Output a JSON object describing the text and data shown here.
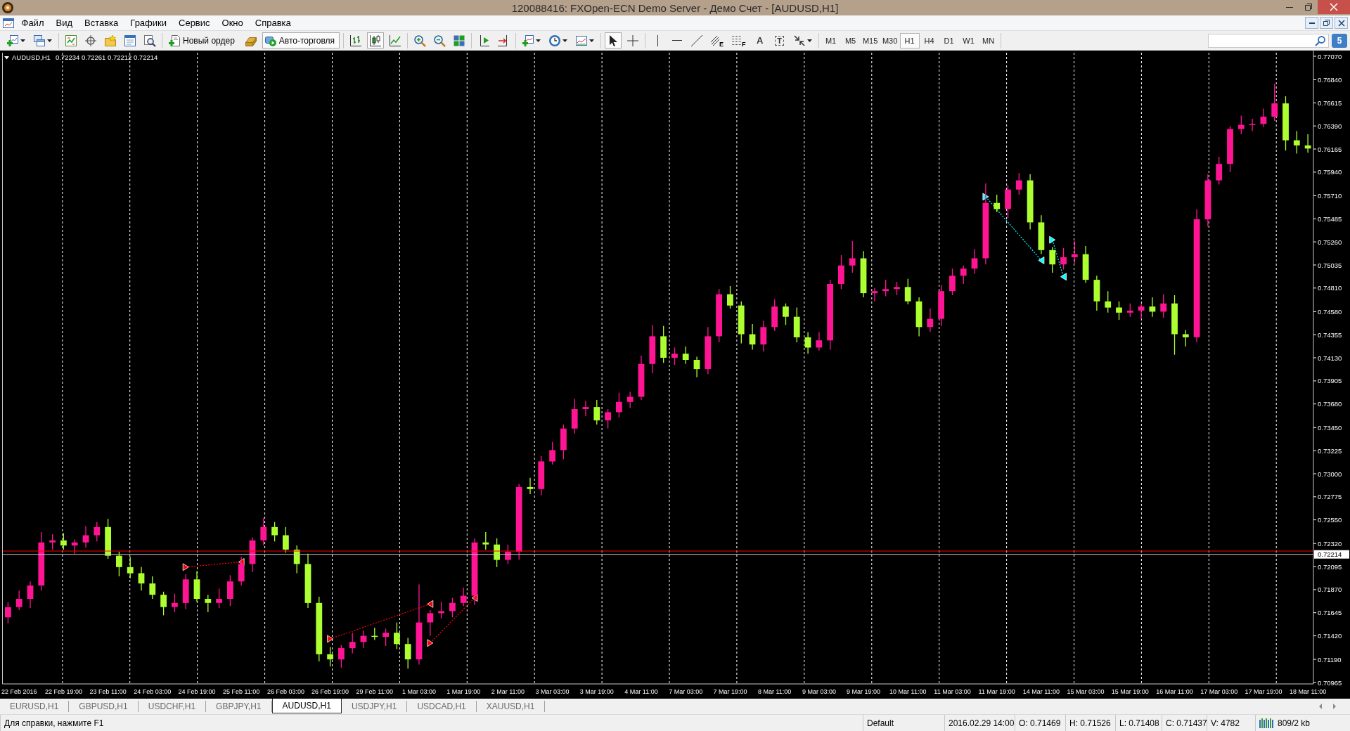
{
  "window": {
    "title": "120088416: FXOpen-ECN Demo Server - Демо Счет - [AUDUSD,H1]"
  },
  "menu": [
    "Файл",
    "Вид",
    "Вставка",
    "Графики",
    "Сервис",
    "Окно",
    "Справка"
  ],
  "toolbar": {
    "new_order": "Новый ордер",
    "auto_trading": {
      "label": "Авто-торговля",
      "on": true
    },
    "chart_types": [
      {
        "selected": false
      },
      {
        "selected": true
      },
      {
        "selected": false
      }
    ],
    "cursor_tools": [
      {
        "selected": true
      },
      {
        "selected": false
      }
    ],
    "object_tools": {
      "channel": "E",
      "fibonacci": "F",
      "text": "A",
      "text_label": "T"
    },
    "timeframes": [
      {
        "label": "M1",
        "selected": false
      },
      {
        "label": "M5",
        "selected": false
      },
      {
        "label": "M15",
        "selected": false
      },
      {
        "label": "M30",
        "selected": false
      },
      {
        "label": "H1",
        "selected": true
      },
      {
        "label": "H4",
        "selected": false
      },
      {
        "label": "D1",
        "selected": false
      },
      {
        "label": "W1",
        "selected": false
      },
      {
        "label": "MN",
        "selected": false
      }
    ],
    "messages": "5"
  },
  "chart": {
    "chart_data": [
      {
        "type": "candlestick",
        "title": "AUDUSD,H1",
        "subtitle": "0.72234 0.72261 0.72212 0.72214",
        "categories": [
          null,
          "22 Feb 2016",
          null,
          null,
          null,
          "22 Feb 19:00",
          null,
          null,
          null,
          "23 Feb 11:00",
          null,
          null,
          null,
          "24 Feb 03:00",
          null,
          null,
          null,
          "24 Feb 19:00",
          null,
          null,
          null,
          "25 Feb 11:00",
          null,
          null,
          null,
          "26 Feb 03:00",
          null,
          null,
          null,
          "26 Feb 19:00",
          null,
          null,
          null,
          "29 Feb 11:00",
          null,
          null,
          null,
          "1 Mar 03:00",
          null,
          null,
          null,
          "1 Mar 19:00",
          null,
          null,
          null,
          "2 Mar 11:00",
          null,
          null,
          null,
          "3 Mar 03:00",
          null,
          null,
          null,
          "3 Mar 19:00",
          null,
          null,
          null,
          "4 Mar 11:00",
          null,
          null,
          null,
          "7 Mar 03:00",
          null,
          null,
          null,
          "7 Mar 19:00",
          null,
          null,
          null,
          "8 Mar 11:00",
          null,
          null,
          null,
          "9 Mar 03:00",
          null,
          null,
          null,
          "9 Mar 19:00",
          null,
          null,
          null,
          "10 Mar 11:00",
          null,
          null,
          null,
          "11 Mar 03:00",
          null,
          null,
          null,
          "11 Mar 19:00",
          null,
          null,
          null,
          "14 Mar 11:00",
          null,
          null,
          null,
          "15 Mar 03:00",
          null,
          null,
          null,
          "15 Mar 19:00",
          null,
          null,
          null,
          "16 Mar 11:00",
          null,
          null,
          null,
          "17 Mar 03:00",
          null,
          null,
          null,
          "17 Mar 19:00",
          null,
          null,
          null,
          "18 Mar 11:00"
        ],
        "ohlc": [
          [
            0.716,
            0.7175,
            0.7154,
            0.717
          ],
          [
            0.717,
            0.7186,
            0.7167,
            0.7178
          ],
          [
            0.7178,
            0.7195,
            0.7169,
            0.7191
          ],
          [
            0.7191,
            0.7243,
            0.7186,
            0.7233
          ],
          [
            0.7233,
            0.7241,
            0.7226,
            0.7235
          ],
          [
            0.7235,
            0.7242,
            0.7226,
            0.723
          ],
          [
            0.723,
            0.7236,
            0.7222,
            0.7233
          ],
          [
            0.7233,
            0.7249,
            0.7228,
            0.724
          ],
          [
            0.724,
            0.7253,
            0.7234,
            0.7248
          ],
          [
            0.7248,
            0.7256,
            0.7217,
            0.722
          ],
          [
            0.722,
            0.7224,
            0.72,
            0.7209
          ],
          [
            0.7209,
            0.7219,
            0.7198,
            0.7203
          ],
          [
            0.7203,
            0.7209,
            0.7186,
            0.7193
          ],
          [
            0.7193,
            0.72,
            0.7178,
            0.7182
          ],
          [
            0.7182,
            0.7185,
            0.7162,
            0.717
          ],
          [
            0.717,
            0.7183,
            0.7165,
            0.7174
          ],
          [
            0.7174,
            0.7202,
            0.7168,
            0.7197
          ],
          [
            0.7197,
            0.7205,
            0.7175,
            0.7178
          ],
          [
            0.7178,
            0.7182,
            0.7165,
            0.7174
          ],
          [
            0.7174,
            0.7188,
            0.7169,
            0.7178
          ],
          [
            0.7178,
            0.7201,
            0.7171,
            0.7195
          ],
          [
            0.7195,
            0.7219,
            0.7191,
            0.7212
          ],
          [
            0.7212,
            0.7238,
            0.7204,
            0.7235
          ],
          [
            0.7235,
            0.7257,
            0.723,
            0.7248
          ],
          [
            0.7248,
            0.7253,
            0.7234,
            0.724
          ],
          [
            0.724,
            0.7248,
            0.7223,
            0.7226
          ],
          [
            0.7226,
            0.723,
            0.7203,
            0.7212
          ],
          [
            0.7212,
            0.7222,
            0.7169,
            0.7174
          ],
          [
            0.7174,
            0.718,
            0.7117,
            0.7124
          ],
          [
            0.7124,
            0.7131,
            0.7112,
            0.7119
          ],
          [
            0.7119,
            0.7133,
            0.7111,
            0.713
          ],
          [
            0.713,
            0.7145,
            0.7125,
            0.7136
          ],
          [
            0.7136,
            0.7147,
            0.713,
            0.7142
          ],
          [
            0.7142,
            0.715,
            0.7138,
            0.7141
          ],
          [
            0.7141,
            0.7149,
            0.7132,
            0.7145
          ],
          [
            0.7145,
            0.7155,
            0.7129,
            0.7134
          ],
          [
            0.7134,
            0.714,
            0.711,
            0.7119
          ],
          [
            0.7119,
            0.7192,
            0.7114,
            0.7155
          ],
          [
            0.7155,
            0.7167,
            0.7142,
            0.7164
          ],
          [
            0.7164,
            0.7175,
            0.7159,
            0.7166
          ],
          [
            0.7166,
            0.7179,
            0.716,
            0.7174
          ],
          [
            0.7174,
            0.7189,
            0.7171,
            0.7181
          ],
          [
            0.7181,
            0.7237,
            0.7172,
            0.7233
          ],
          [
            0.7233,
            0.7243,
            0.7226,
            0.7231
          ],
          [
            0.7231,
            0.7237,
            0.7209,
            0.7216
          ],
          [
            0.7216,
            0.7231,
            0.7212,
            0.7224
          ],
          [
            0.7224,
            0.729,
            0.7216,
            0.7287
          ],
          [
            0.7287,
            0.7296,
            0.728,
            0.7285
          ],
          [
            0.7285,
            0.7317,
            0.7279,
            0.7312
          ],
          [
            0.7312,
            0.7331,
            0.7309,
            0.7323
          ],
          [
            0.7323,
            0.7348,
            0.7314,
            0.7344
          ],
          [
            0.7344,
            0.7373,
            0.7339,
            0.7363
          ],
          [
            0.7363,
            0.7371,
            0.7356,
            0.7365
          ],
          [
            0.7365,
            0.7372,
            0.7348,
            0.7352
          ],
          [
            0.7352,
            0.7363,
            0.7344,
            0.736
          ],
          [
            0.736,
            0.7379,
            0.7355,
            0.737
          ],
          [
            0.737,
            0.738,
            0.7364,
            0.7375
          ],
          [
            0.7375,
            0.7415,
            0.7372,
            0.7407
          ],
          [
            0.7407,
            0.7445,
            0.7398,
            0.7434
          ],
          [
            0.7434,
            0.7444,
            0.7408,
            0.7413
          ],
          [
            0.7413,
            0.7423,
            0.7406,
            0.7417
          ],
          [
            0.7417,
            0.7424,
            0.7407,
            0.7411
          ],
          [
            0.7411,
            0.7414,
            0.7394,
            0.7402
          ],
          [
            0.7402,
            0.7443,
            0.7397,
            0.7434
          ],
          [
            0.7434,
            0.748,
            0.7428,
            0.7475
          ],
          [
            0.7475,
            0.7483,
            0.7461,
            0.7464
          ],
          [
            0.7464,
            0.7468,
            0.7427,
            0.7436
          ],
          [
            0.7436,
            0.7446,
            0.7421,
            0.7426
          ],
          [
            0.7426,
            0.7449,
            0.7419,
            0.7443
          ],
          [
            0.7443,
            0.747,
            0.7439,
            0.7463
          ],
          [
            0.7463,
            0.7466,
            0.7445,
            0.7453
          ],
          [
            0.7453,
            0.7462,
            0.7428,
            0.7433
          ],
          [
            0.7433,
            0.7438,
            0.7417,
            0.7423
          ],
          [
            0.7423,
            0.7438,
            0.742,
            0.743
          ],
          [
            0.743,
            0.7489,
            0.7421,
            0.7485
          ],
          [
            0.7485,
            0.7513,
            0.748,
            0.7503
          ],
          [
            0.7503,
            0.7527,
            0.7496,
            0.751
          ],
          [
            0.751,
            0.7517,
            0.7472,
            0.7476
          ],
          [
            0.7476,
            0.7481,
            0.7468,
            0.7478
          ],
          [
            0.7478,
            0.7489,
            0.7473,
            0.748
          ],
          [
            0.748,
            0.7487,
            0.7474,
            0.7482
          ],
          [
            0.7482,
            0.749,
            0.7465,
            0.7468
          ],
          [
            0.7468,
            0.7472,
            0.7434,
            0.7443
          ],
          [
            0.7443,
            0.7461,
            0.7438,
            0.7451
          ],
          [
            0.7451,
            0.7484,
            0.7444,
            0.7478
          ],
          [
            0.7478,
            0.75,
            0.7474,
            0.7493
          ],
          [
            0.7493,
            0.7503,
            0.7485,
            0.75
          ],
          [
            0.75,
            0.7519,
            0.7495,
            0.751
          ],
          [
            0.751,
            0.7583,
            0.7504,
            0.7564
          ],
          [
            0.7564,
            0.7572,
            0.7555,
            0.7558
          ],
          [
            0.7558,
            0.7581,
            0.7549,
            0.7577
          ],
          [
            0.7577,
            0.7593,
            0.7572,
            0.7586
          ],
          [
            0.7586,
            0.7592,
            0.7538,
            0.7545
          ],
          [
            0.7545,
            0.7552,
            0.7514,
            0.7518
          ],
          [
            0.7518,
            0.7521,
            0.7496,
            0.7504
          ],
          [
            0.7504,
            0.752,
            0.7499,
            0.7511
          ],
          [
            0.7511,
            0.7527,
            0.7505,
            0.7514
          ],
          [
            0.7514,
            0.7522,
            0.7486,
            0.7489
          ],
          [
            0.7489,
            0.7493,
            0.7459,
            0.7468
          ],
          [
            0.7468,
            0.7478,
            0.7457,
            0.7462
          ],
          [
            0.7462,
            0.7468,
            0.745,
            0.7457
          ],
          [
            0.7457,
            0.7466,
            0.7453,
            0.7459
          ],
          [
            0.7459,
            0.7466,
            0.7451,
            0.7463
          ],
          [
            0.7463,
            0.7472,
            0.7453,
            0.7458
          ],
          [
            0.7458,
            0.7475,
            0.7452,
            0.7466
          ],
          [
            0.7466,
            0.7474,
            0.7416,
            0.7436
          ],
          [
            0.7436,
            0.744,
            0.7424,
            0.7433
          ],
          [
            0.7433,
            0.7558,
            0.7428,
            0.7548
          ],
          [
            0.7548,
            0.7592,
            0.7541,
            0.7586
          ],
          [
            0.7586,
            0.7609,
            0.7582,
            0.7602
          ],
          [
            0.7602,
            0.7639,
            0.7594,
            0.7636
          ],
          [
            0.7636,
            0.7649,
            0.7631,
            0.764
          ],
          [
            0.764,
            0.7646,
            0.7634,
            0.7641
          ],
          [
            0.7641,
            0.7656,
            0.7638,
            0.7648
          ],
          [
            0.7648,
            0.768,
            0.7644,
            0.7661
          ],
          [
            0.7661,
            0.7668,
            0.7615,
            0.7625
          ],
          [
            0.7625,
            0.7634,
            0.7612,
            0.762
          ],
          [
            0.762,
            0.7631,
            0.7613,
            0.7617
          ]
        ],
        "series": [
          {
            "type": "line",
            "color": "#ff0000",
            "line_style": "dotted",
            "marker": "triangle",
            "values": [
              null,
              null,
              null,
              null,
              null,
              null,
              null,
              null,
              null,
              null,
              null,
              null,
              null,
              null,
              null,
              null,
              0.7209,
              null,
              null,
              null,
              null,
              0.7214,
              null,
              null,
              null,
              null,
              null,
              null,
              null,
              null,
              null,
              null,
              null,
              null,
              null,
              null,
              null,
              null,
              null,
              null,
              null,
              null,
              null,
              null,
              null,
              null,
              null,
              null,
              null,
              null,
              null,
              null,
              null,
              null,
              null,
              null,
              null,
              null,
              null,
              null,
              null,
              null,
              null,
              null,
              null,
              null,
              null,
              null,
              null,
              null,
              null,
              null,
              null,
              null,
              null,
              null,
              null,
              null,
              null,
              null,
              null,
              null,
              null,
              null,
              null,
              null,
              null,
              null,
              null,
              null,
              null,
              null,
              null,
              null,
              null,
              null,
              null,
              null,
              null,
              null,
              null,
              null,
              null,
              null,
              null,
              null,
              null,
              null,
              null,
              null,
              null,
              null,
              null,
              null,
              null,
              null,
              null,
              null
            ]
          },
          {
            "type": "line",
            "color": "#ff0000",
            "line_style": "dotted",
            "marker": "triangle",
            "values": [
              null,
              null,
              null,
              null,
              null,
              null,
              null,
              null,
              null,
              null,
              null,
              null,
              null,
              null,
              null,
              null,
              null,
              null,
              null,
              null,
              null,
              null,
              null,
              null,
              null,
              null,
              null,
              null,
              null,
              0.7139,
              null,
              null,
              null,
              null,
              null,
              null,
              null,
              null,
              0.7173,
              null,
              null,
              null,
              null,
              null,
              null,
              null,
              null,
              null,
              null,
              null,
              null,
              null,
              null,
              null,
              null,
              null,
              null,
              null,
              null,
              null,
              null,
              null,
              null,
              null,
              null,
              null,
              null,
              null,
              null,
              null,
              null,
              null,
              null,
              null,
              null,
              null,
              null,
              null,
              null,
              null,
              null,
              null,
              null,
              null,
              null,
              null,
              null,
              null,
              null,
              null,
              null,
              null,
              null,
              null,
              null,
              null,
              null,
              null,
              null,
              null,
              null,
              null,
              null,
              null,
              null,
              null,
              null,
              null,
              null,
              null,
              null,
              null,
              null,
              null,
              null,
              null,
              null,
              null
            ]
          },
          {
            "type": "line",
            "color": "#ff0000",
            "line_style": "dotted",
            "marker": "triangle",
            "values": [
              null,
              null,
              null,
              null,
              null,
              null,
              null,
              null,
              null,
              null,
              null,
              null,
              null,
              null,
              null,
              null,
              null,
              null,
              null,
              null,
              null,
              null,
              null,
              null,
              null,
              null,
              null,
              null,
              null,
              null,
              null,
              null,
              null,
              null,
              null,
              null,
              null,
              null,
              0.7135,
              null,
              null,
              null,
              0.7179,
              null,
              null,
              null,
              null,
              null,
              null,
              null,
              null,
              null,
              null,
              null,
              null,
              null,
              null,
              null,
              null,
              null,
              null,
              null,
              null,
              null,
              null,
              null,
              null,
              null,
              null,
              null,
              null,
              null,
              null,
              null,
              null,
              null,
              null,
              null,
              null,
              null,
              null,
              null,
              null,
              null,
              null,
              null,
              null,
              null,
              null,
              null,
              null,
              null,
              null,
              null,
              null,
              null,
              null,
              null,
              null,
              null,
              null,
              null,
              null,
              null,
              null,
              null,
              null,
              null,
              null,
              null,
              null,
              null,
              null,
              null,
              null,
              null,
              null,
              null
            ]
          },
          {
            "type": "line",
            "color": "#00ffff",
            "line_style": "dotted",
            "marker": "triangle",
            "values": [
              null,
              null,
              null,
              null,
              null,
              null,
              null,
              null,
              null,
              null,
              null,
              null,
              null,
              null,
              null,
              null,
              null,
              null,
              null,
              null,
              null,
              null,
              null,
              null,
              null,
              null,
              null,
              null,
              null,
              null,
              null,
              null,
              null,
              null,
              null,
              null,
              null,
              null,
              null,
              null,
              null,
              null,
              null,
              null,
              null,
              null,
              null,
              null,
              null,
              null,
              null,
              null,
              null,
              null,
              null,
              null,
              null,
              null,
              null,
              null,
              null,
              null,
              null,
              null,
              null,
              null,
              null,
              null,
              null,
              null,
              null,
              null,
              null,
              null,
              null,
              null,
              null,
              null,
              null,
              null,
              null,
              null,
              null,
              null,
              null,
              null,
              null,
              null,
              0.757,
              null,
              null,
              null,
              null,
              0.7508,
              null,
              null,
              null,
              null,
              null,
              null,
              null,
              null,
              null,
              null,
              null,
              null,
              null,
              null,
              null,
              null,
              null,
              null,
              null,
              null,
              null,
              null,
              null,
              null
            ]
          },
          {
            "type": "line",
            "color": "#00ffff",
            "line_style": "dotted",
            "marker": "triangle",
            "values": [
              null,
              null,
              null,
              null,
              null,
              null,
              null,
              null,
              null,
              null,
              null,
              null,
              null,
              null,
              null,
              null,
              null,
              null,
              null,
              null,
              null,
              null,
              null,
              null,
              null,
              null,
              null,
              null,
              null,
              null,
              null,
              null,
              null,
              null,
              null,
              null,
              null,
              null,
              null,
              null,
              null,
              null,
              null,
              null,
              null,
              null,
              null,
              null,
              null,
              null,
              null,
              null,
              null,
              null,
              null,
              null,
              null,
              null,
              null,
              null,
              null,
              null,
              null,
              null,
              null,
              null,
              null,
              null,
              null,
              null,
              null,
              null,
              null,
              null,
              null,
              null,
              null,
              null,
              null,
              null,
              null,
              null,
              null,
              null,
              null,
              null,
              null,
              null,
              null,
              null,
              null,
              null,
              null,
              null,
              0.7528,
              0.7492,
              null,
              null,
              null,
              null,
              null,
              null,
              null,
              null,
              null,
              null,
              null,
              null,
              null,
              null,
              null,
              null,
              null,
              null,
              null,
              null,
              null,
              null
            ]
          }
        ],
        "ylim": [
          0.70951,
          0.77104
        ],
        "yticks": [
          {
            "value": 0.7707,
            "label": "0.77070"
          },
          {
            "value": 0.7684,
            "label": "0.76840"
          },
          {
            "value": 0.76615,
            "label": "0.76615"
          },
          {
            "value": 0.7639,
            "label": "0.76390"
          },
          {
            "value": 0.76165,
            "label": "0.76165"
          },
          {
            "value": 0.7594,
            "label": "0.75940"
          },
          {
            "value": 0.7571,
            "label": "0.75710"
          },
          {
            "value": 0.75485,
            "label": "0.75485"
          },
          {
            "value": 0.7526,
            "label": "0.75260"
          },
          {
            "value": 0.75035,
            "label": "0.75035"
          },
          {
            "value": 0.7481,
            "label": "0.74810"
          },
          {
            "value": 0.7458,
            "label": "0.74580"
          },
          {
            "value": 0.74355,
            "label": "0.74355"
          },
          {
            "value": 0.7413,
            "label": "0.74130"
          },
          {
            "value": 0.73905,
            "label": "0.73905"
          },
          {
            "value": 0.7368,
            "label": "0.73680"
          },
          {
            "value": 0.7345,
            "label": "0.73450"
          },
          {
            "value": 0.73225,
            "label": "0.73225"
          },
          {
            "value": 0.73,
            "label": "0.73000"
          },
          {
            "value": 0.72775,
            "label": "0.72775"
          },
          {
            "value": 0.7255,
            "label": "0.72550"
          },
          {
            "value": 0.7232,
            "label": "0.72320"
          },
          {
            "value": 0.72095,
            "label": "0.72095"
          },
          {
            "value": 0.7187,
            "label": "0.71870"
          },
          {
            "value": 0.71645,
            "label": "0.71645"
          },
          {
            "value": 0.7142,
            "label": "0.71420"
          },
          {
            "value": 0.7119,
            "label": "0.71190"
          },
          {
            "value": 0.70965,
            "label": "0.70965"
          }
        ],
        "ref_lines": [
          {
            "axis": "y",
            "value": 0.72246,
            "color": "#ff0000",
            "line_style": "solid"
          },
          {
            "axis": "y",
            "value": 0.72214,
            "label": "0.72214",
            "color": "#c0c0c0",
            "line_style": "solid"
          }
        ]
      }
    ]
  },
  "tabs": [
    {
      "label": "EURUSD,H1",
      "selected": false
    },
    {
      "label": "GBPUSD,H1",
      "selected": false
    },
    {
      "label": "USDCHF,H1",
      "selected": false
    },
    {
      "label": "GBPJPY,H1",
      "selected": false
    },
    {
      "label": "AUDUSD,H1",
      "selected": true
    },
    {
      "label": "USDJPY,H1",
      "selected": false
    },
    {
      "label": "USDCAD,H1",
      "selected": false
    },
    {
      "label": "XAUUSD,H1",
      "selected": false
    }
  ],
  "status_bar": {
    "help": "Для справки, нажмите F1",
    "profile": "Default",
    "time": "2016.02.29 14:00",
    "open": "O: 0.71469",
    "high": "H: 0.71526",
    "low": "L: 0.71408",
    "close": "C: 0.71437",
    "volume": "V: 4782",
    "traffic": "809/2 kb"
  }
}
